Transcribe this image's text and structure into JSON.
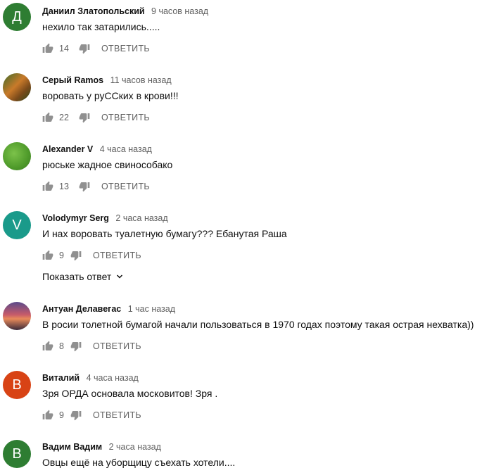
{
  "comments": [
    {
      "author": "Даниил Златопольский",
      "time": "9 часов назад",
      "text": "нехило так затарились.....",
      "likes": "14",
      "reply": "ОТВЕТИТЬ",
      "avatar_letter": "Д",
      "avatar_color": "#2e7d32"
    },
    {
      "author": "Серый Ramos",
      "time": "11 часов назад",
      "text": "воровать у руССких в крови!!!",
      "likes": "22",
      "reply": "ОТВЕТИТЬ",
      "avatar_letter": "",
      "avatar_color": "#8a6b2e"
    },
    {
      "author": "Alexander V",
      "time": "4 часа назад",
      "text": "рюське жадное свинособако",
      "likes": "13",
      "reply": "ОТВЕТИТЬ",
      "avatar_letter": "",
      "avatar_color": "#5aa832"
    },
    {
      "author": "Volodymyr Serg",
      "time": "2 часа назад",
      "text": "И нах воровать туалетную бумагу??? Ебанутая Раша",
      "likes": "9",
      "reply": "ОТВЕТИТЬ",
      "avatar_letter": "V",
      "avatar_color": "#1a9a8a"
    },
    {
      "author": "Антуан Делавегас",
      "time": "1 час назад",
      "text": "В росии толетной бумагой начали пользоваться в 1970 годах поэтому такая острая нехватка))",
      "likes": "8",
      "reply": "ОТВЕТИТЬ",
      "avatar_letter": "",
      "avatar_color": "#7a5a8a"
    },
    {
      "author": "Виталий",
      "time": "4 часа назад",
      "text": "Зря ОРДА основала московитов! Зря .",
      "likes": "9",
      "reply": "ОТВЕТИТЬ",
      "avatar_letter": "В",
      "avatar_color": "#d84315"
    },
    {
      "author": "Вадим Вадим",
      "time": "2 часа назад",
      "text": "Овцы ещё на уборщицу съехать хотели....",
      "likes": "",
      "reply": "",
      "avatar_letter": "В",
      "avatar_color": "#2e7d32"
    }
  ],
  "show_replies": "Показать ответ",
  "icons": {
    "like": "thumb-up-icon",
    "dislike": "thumb-down-icon",
    "chevron": "chevron-down-icon"
  }
}
